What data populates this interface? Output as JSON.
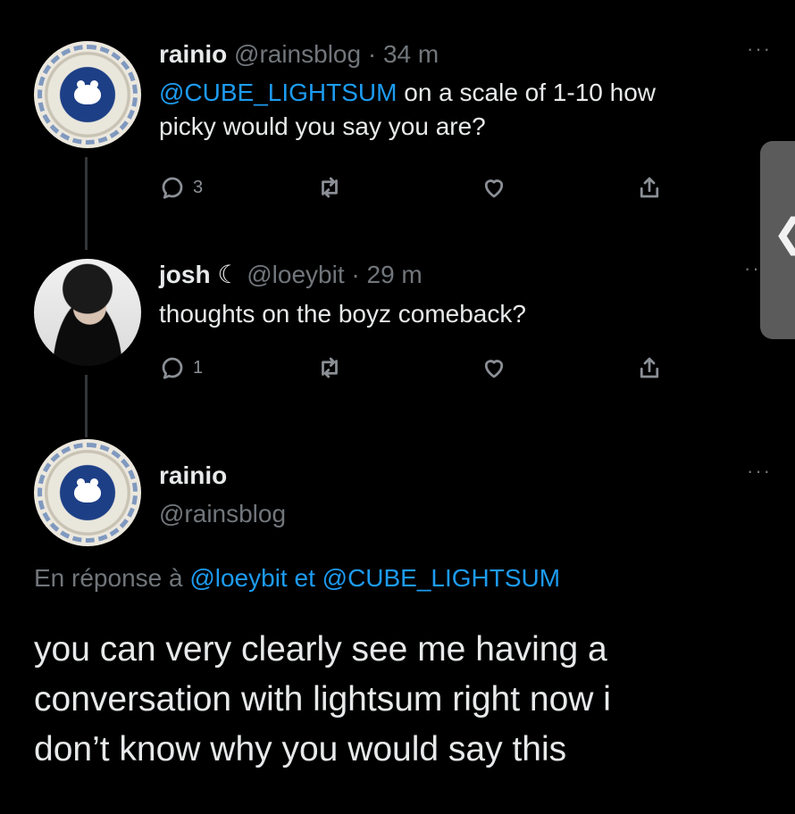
{
  "tweets": [
    {
      "display_name": "rainio",
      "handle": "@rainsblog",
      "time": "· 34 m",
      "mention": "@CUBE_LIGHTSUM",
      "text_after_mention": " on a scale of 1-10 how",
      "text_line2": "picky would you say you are?",
      "replies": "3",
      "more": "···"
    },
    {
      "display_name": "josh",
      "moon": "☾",
      "handle": "@loeybit",
      "time": "· 29 m",
      "text": "thoughts on the boyz comeback?",
      "replies": "1",
      "more": "··"
    }
  ],
  "main_tweet": {
    "display_name": "rainio",
    "handle": "@rainsblog",
    "more": "···",
    "reply_prefix": "En réponse à ",
    "reply_user1": "@loeybit",
    "reply_and": " et ",
    "reply_user2": "@CUBE_LIGHTSUM",
    "text_lines": [
      "you can very clearly see me having a",
      "conversation with lightsum right now i",
      "don’t know why you would say this"
    ]
  },
  "side_tab": {
    "label": "❮"
  },
  "icons": [
    "reply-icon",
    "retweet-icon",
    "like-icon",
    "share-icon",
    "more-icon",
    "plate-avatar",
    "photo-avatar"
  ],
  "colors": {
    "background": "#000000",
    "text": "#e7e9ea",
    "muted": "#71767b",
    "link": "#1d9bf0"
  }
}
